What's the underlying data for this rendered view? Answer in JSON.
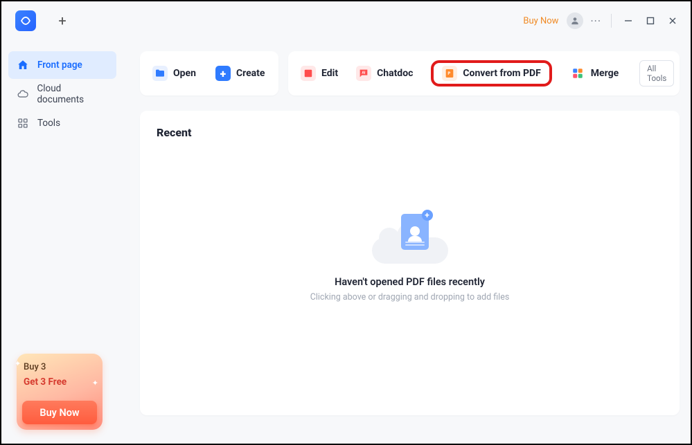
{
  "titlebar": {
    "buy_now": "Buy Now"
  },
  "sidebar": {
    "items": [
      {
        "label": "Front page"
      },
      {
        "label": "Cloud documents"
      },
      {
        "label": "Tools"
      }
    ]
  },
  "toolbar": {
    "open": "Open",
    "create": "Create",
    "edit": "Edit",
    "chatdoc": "Chatdoc",
    "convert": "Convert from PDF",
    "merge": "Merge",
    "all_tools": "All Tools"
  },
  "recent": {
    "title": "Recent",
    "empty_title": "Haven't opened PDF files recently",
    "empty_sub": "Clicking above or dragging and dropping to add files"
  },
  "promo": {
    "line1": "Buy 3",
    "line2": "Get 3 Free",
    "button": "Buy Now"
  }
}
